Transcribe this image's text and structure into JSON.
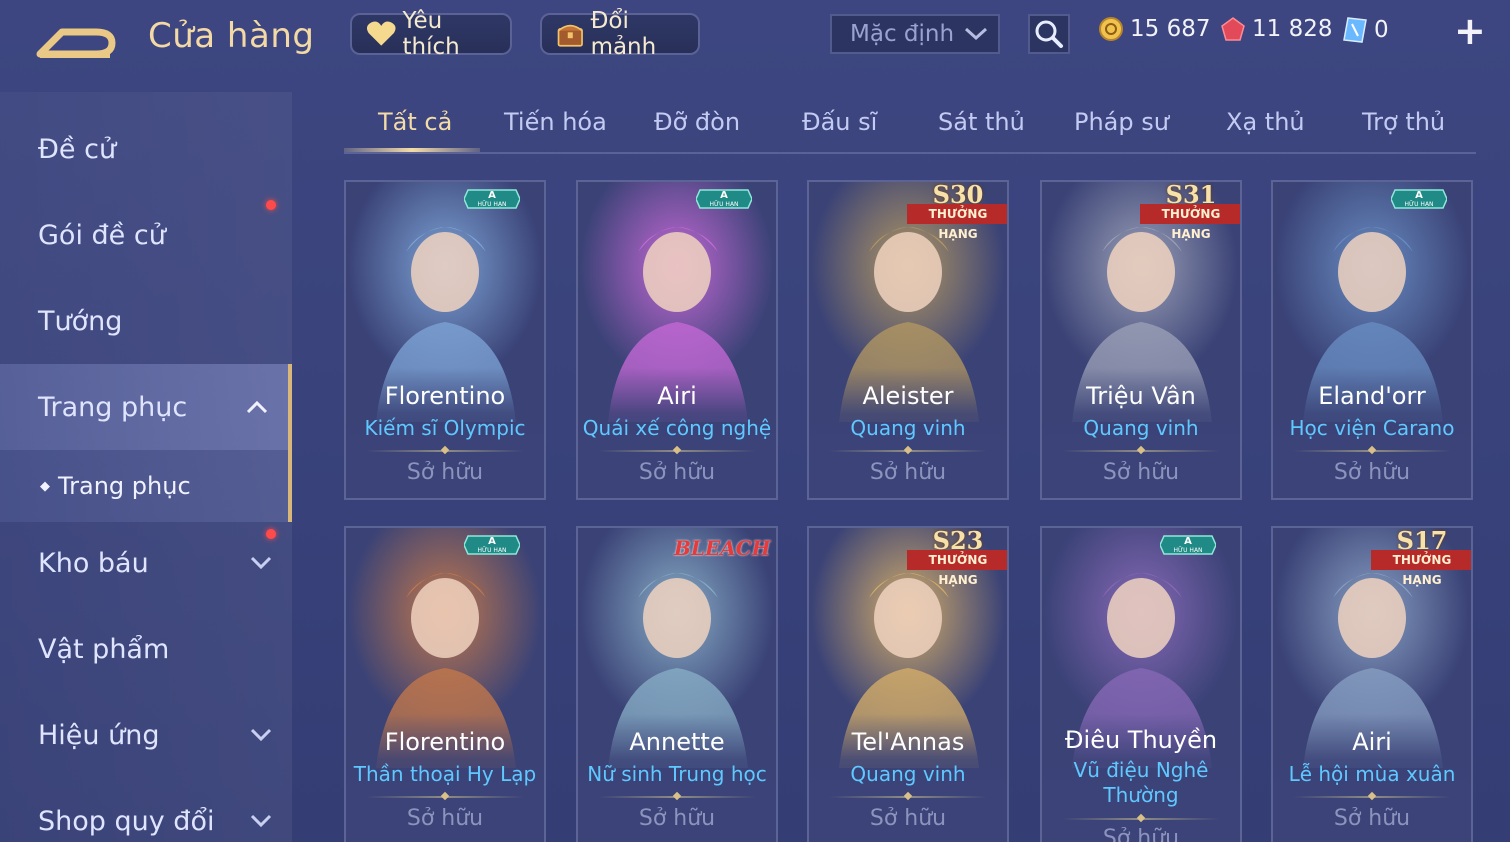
{
  "header": {
    "title": "Cửa hàng",
    "favorite_label": "Yêu thích",
    "exchange_label": "Đổi mảnh",
    "sort_value": "Mặc định"
  },
  "currency": {
    "gold": "15 687",
    "voucher": "11 828",
    "ticket": "0"
  },
  "sidebar": {
    "items": [
      {
        "label": "Đề cử"
      },
      {
        "label": "Gói đề cử"
      },
      {
        "label": "Tướng"
      },
      {
        "label": "Trang phục"
      },
      {
        "label": "Kho báu"
      },
      {
        "label": "Vật phẩm"
      },
      {
        "label": "Hiệu ứng"
      },
      {
        "label": "Shop quy đổi"
      }
    ],
    "sub_item": "Trang phục"
  },
  "tabs": [
    "Tất cả",
    "Tiến hóa",
    "Đỡ đòn",
    "Đấu sĩ",
    "Sát thủ",
    "Pháp sư",
    "Xạ thủ",
    "Trợ thủ"
  ],
  "cards": [
    {
      "hero": "Florentino",
      "skin": "Kiếm sĩ Olympic",
      "status": "Sở hữu",
      "badge": "A",
      "badge_sub": "HỮU HẠN",
      "accent": "#7fa6d8"
    },
    {
      "hero": "Airi",
      "skin": "Quái xế công nghệ",
      "status": "Sở hữu",
      "badge": "A",
      "badge_sub": "HỮU HẠN",
      "accent": "#c86ad8"
    },
    {
      "hero": "Aleister",
      "skin": "Quang vinh",
      "status": "Sở hữu",
      "badge": "S30",
      "badge_sub": "THƯỞNG HẠNG",
      "accent": "#b59a62"
    },
    {
      "hero": "Triệu Vân",
      "skin": "Quang vinh",
      "status": "Sở hữu",
      "badge": "S31",
      "badge_sub": "THƯỞNG HẠNG",
      "accent": "#9ea3b8"
    },
    {
      "hero": "Eland'orr",
      "skin": "Học viện Carano",
      "status": "Sở hữu",
      "badge": "A",
      "badge_sub": "HỮU HẠN",
      "accent": "#6a8fc4"
    },
    {
      "hero": "Florentino",
      "skin": "Thần thoại Hy Lạp",
      "status": "Sở hữu",
      "badge": "A",
      "badge_sub": "HỮU HẠN",
      "accent": "#c77a4a"
    },
    {
      "hero": "Annette",
      "skin": "Nữ sinh Trung học",
      "status": "Sở hữu",
      "badge": "BLEACH",
      "badge_sub": "",
      "accent": "#8ab0c8"
    },
    {
      "hero": "Tel'Annas",
      "skin": "Quang vinh",
      "status": "Sở hữu",
      "badge": "S23",
      "badge_sub": "THƯỞNG HẠNG",
      "accent": "#d8b068"
    },
    {
      "hero": "Điêu Thuyền",
      "skin": "Vũ điệu Nghê Thường",
      "status": "Sở hữu",
      "badge": "A",
      "badge_sub": "HỮU HẠN",
      "accent": "#8a6ab8"
    },
    {
      "hero": "Airi",
      "skin": "Lễ hội mùa xuân",
      "status": "Sở hữu",
      "badge": "S17",
      "badge_sub": "THƯỞNG HẠNG",
      "accent": "#8aa2c4"
    }
  ]
}
